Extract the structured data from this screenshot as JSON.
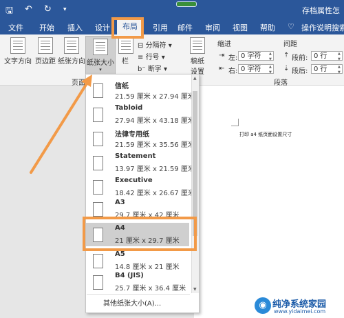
{
  "title_bar": {
    "quick_access": [
      "save-icon",
      "undo-icon",
      "redo-icon",
      "customize-icon"
    ],
    "title": "存档属性怎"
  },
  "tabs": [
    {
      "label": "文件",
      "active": false
    },
    {
      "label": "开始",
      "active": false
    },
    {
      "label": "插入",
      "active": false
    },
    {
      "label": "设计",
      "active": false
    },
    {
      "label": "布局",
      "active": true
    },
    {
      "label": "引用",
      "active": false
    },
    {
      "label": "邮件",
      "active": false
    },
    {
      "label": "审阅",
      "active": false
    },
    {
      "label": "视图",
      "active": false
    },
    {
      "label": "帮助",
      "active": false
    }
  ],
  "tell_me": "操作说明搜索",
  "ribbon": {
    "page_setup": {
      "group_label": "页面",
      "text_direction": "文字方向",
      "margins": "页边距",
      "orientation": "纸张方向",
      "size": "纸张大小",
      "columns": "栏",
      "breaks": "分隔符",
      "line_numbers": "行号",
      "hyphenation": "断字"
    },
    "draft": {
      "label1": "稿纸",
      "label2": "设置"
    },
    "paragraph": {
      "group_label": "段落",
      "indent_label": "缩进",
      "spacing_label": "间距",
      "left_label": "左:",
      "right_label": "右:",
      "left_value": "0 字符",
      "right_value": "0 字符",
      "before_label": "段前:",
      "after_label": "段后:",
      "before_value": "0 行",
      "after_value": "0 行"
    }
  },
  "document": {
    "text": "打印 a4 纸页面设置尺寸"
  },
  "paper_sizes": [
    {
      "name": "信纸",
      "dims": "21.59 厘米 x 27.94 厘米",
      "selected": false
    },
    {
      "name": "Tabloid",
      "dims": "27.94 厘米 x 43.18 厘米",
      "selected": false
    },
    {
      "name": "法律专用纸",
      "dims": "21.59 厘米 x 35.56 厘米",
      "selected": false
    },
    {
      "name": "Statement",
      "dims": "13.97 厘米 x 21.59 厘米",
      "selected": false
    },
    {
      "name": "Executive",
      "dims": "18.42 厘米 x 26.67 厘米",
      "selected": false
    },
    {
      "name": "A3",
      "dims": "29.7 厘米 x 42 厘米",
      "selected": false
    },
    {
      "name": "A4",
      "dims": "21 厘米 x 29.7 厘米",
      "selected": true
    },
    {
      "name": "A5",
      "dims": "14.8 厘米 x 21 厘米",
      "selected": false
    },
    {
      "name": "B4 (JIS)",
      "dims": "25.7 厘米 x 36.4 厘米",
      "selected": false
    }
  ],
  "more_sizes": "其他纸张大小(A)...",
  "watermark": {
    "title": "纯净系统家园",
    "url": "www.yidaimei.com"
  },
  "colors": {
    "ribbon_blue": "#2b579a",
    "highlight_orange": "#f29a48"
  }
}
